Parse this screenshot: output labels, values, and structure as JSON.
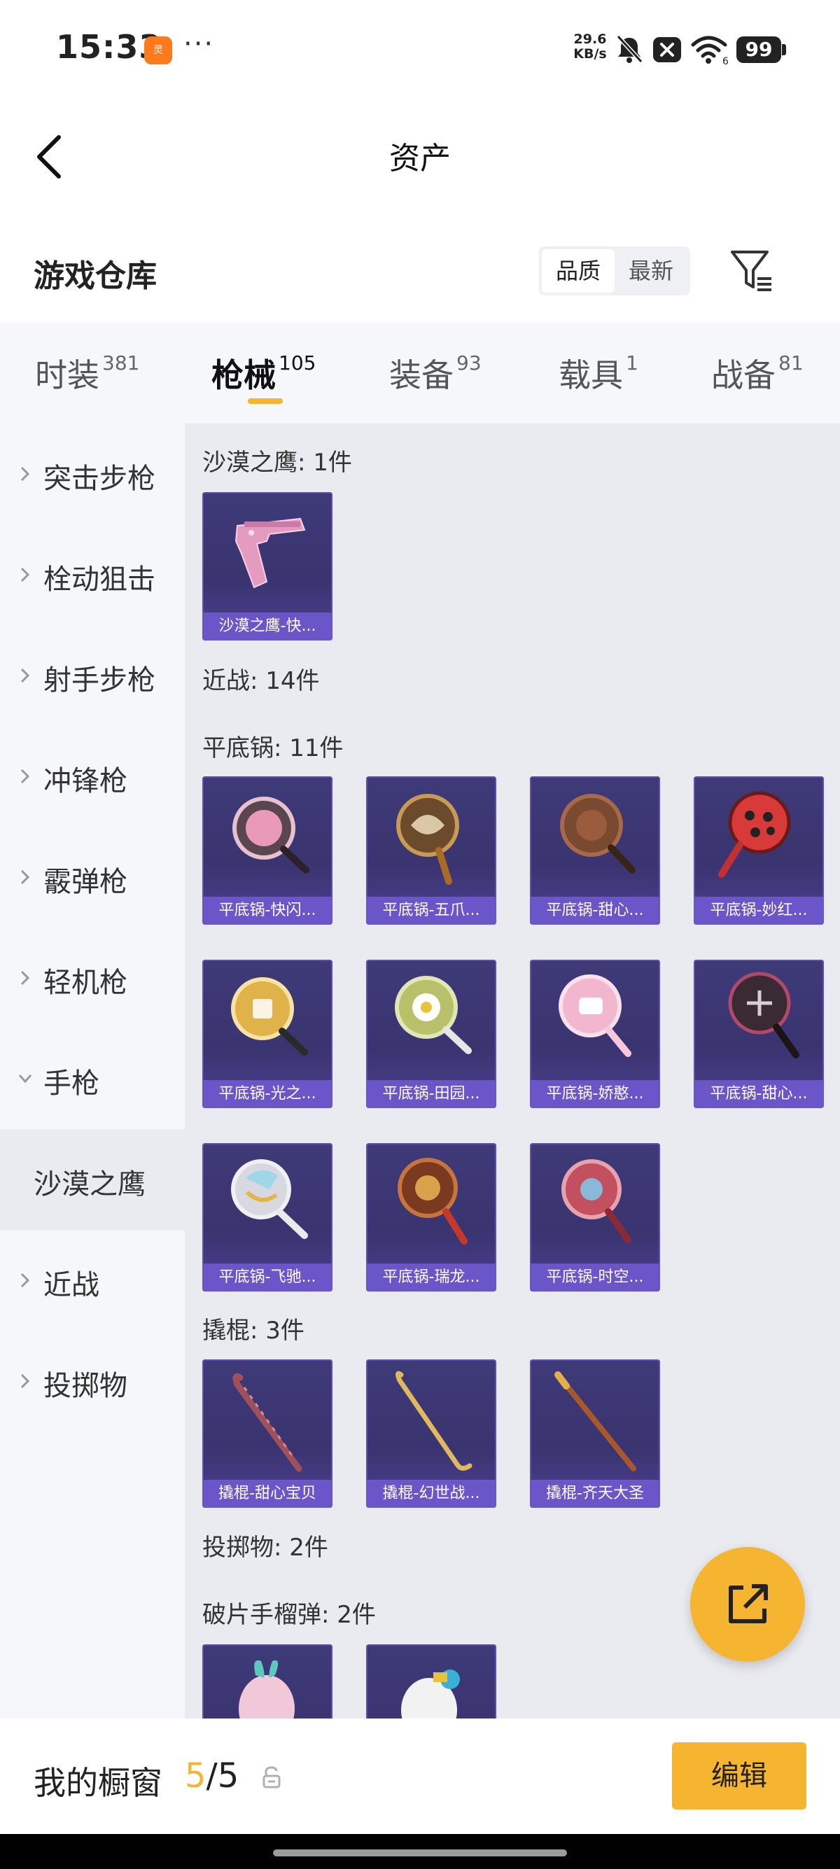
{
  "status_bar": {
    "time": "15:33",
    "app_icon_text": "灵",
    "more": "···",
    "speed_value": "29.6",
    "speed_unit": "KB/s",
    "wifi_label": "6",
    "battery": "99"
  },
  "header": {
    "title": "资产"
  },
  "warehouse": {
    "title": "游戏仓库",
    "sort_options": [
      "品质",
      "最新"
    ],
    "sort_selected": "品质"
  },
  "tabs": [
    {
      "label": "时装",
      "count": "381"
    },
    {
      "label": "枪械",
      "count": "105",
      "active": true
    },
    {
      "label": "装备",
      "count": "93"
    },
    {
      "label": "载具",
      "count": "1"
    },
    {
      "label": "战备",
      "count": "81"
    }
  ],
  "sidebar": [
    {
      "label": "突击步枪"
    },
    {
      "label": "栓动狙击"
    },
    {
      "label": "射手步枪"
    },
    {
      "label": "冲锋枪"
    },
    {
      "label": "霰弹枪"
    },
    {
      "label": "轻机枪"
    },
    {
      "label": "手枪",
      "expanded": true
    },
    {
      "label": "沙漠之鹰",
      "sub": true,
      "selected": true
    },
    {
      "label": "近战"
    },
    {
      "label": "投掷物"
    }
  ],
  "content": {
    "sections": [
      {
        "label": "沙漠之鹰: 1件"
      },
      {
        "label": "近战: 14件"
      },
      {
        "label": "平底锅: 11件"
      },
      {
        "label": "撬棍: 3件"
      },
      {
        "label": "投掷物: 2件"
      },
      {
        "label": "破片手榴弹: 2件"
      }
    ],
    "deagle_items": [
      {
        "name": "沙漠之鹰-快...",
        "icon": "pink-pistol-icon"
      }
    ],
    "pan_items": [
      {
        "name": "平底锅-快闪...",
        "icon": "pan-pink-icon"
      },
      {
        "name": "平底锅-五爪...",
        "icon": "pan-dragon-icon"
      },
      {
        "name": "平底锅-甜心...",
        "icon": "pan-chocolate-icon"
      },
      {
        "name": "平底锅-妙红...",
        "icon": "pan-ladybug-icon"
      },
      {
        "name": "平底锅-光之...",
        "icon": "pan-gold-icon"
      },
      {
        "name": "平底锅-田园...",
        "icon": "pan-daisy-icon"
      },
      {
        "name": "平底锅-娇憨...",
        "icon": "pan-cute-icon"
      },
      {
        "name": "平底锅-甜心...",
        "icon": "pan-dark-icon"
      },
      {
        "name": "平底锅-飞驰...",
        "icon": "pan-wing-icon"
      },
      {
        "name": "平底锅-瑞龙...",
        "icon": "pan-auspicious-icon"
      },
      {
        "name": "平底锅-时空...",
        "icon": "pan-time-icon"
      }
    ],
    "crowbar_items": [
      {
        "name": "撬棍-甜心宝贝",
        "icon": "crowbar-sweet-icon"
      },
      {
        "name": "撬棍-幻世战...",
        "icon": "crowbar-gold-icon"
      },
      {
        "name": "撬棍-齐天大圣",
        "icon": "crowbar-staff-icon"
      }
    ],
    "grenade_items": [
      {
        "name": "",
        "icon": "grenade-bunny-icon"
      },
      {
        "name": "",
        "icon": "grenade-toy-icon"
      }
    ]
  },
  "bottom_bar": {
    "title": "我的橱窗",
    "current": "5",
    "separator": "/",
    "total": "5",
    "edit_label": "编辑"
  },
  "colors": {
    "accent": "#f5b531",
    "card_caption": "#6b56c9",
    "card_bg": "#3e3a78"
  }
}
